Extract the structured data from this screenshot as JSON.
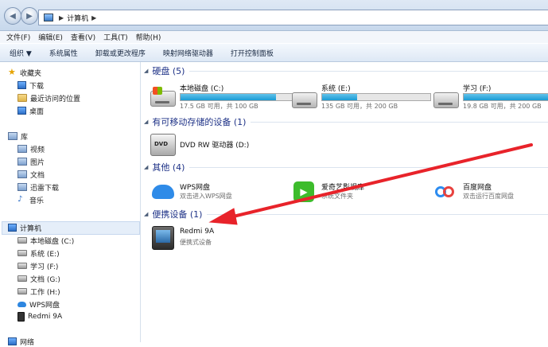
{
  "address": {
    "crumb": "计算机"
  },
  "menu": [
    "文件(F)",
    "编辑(E)",
    "查看(V)",
    "工具(T)",
    "帮助(H)"
  ],
  "toolbar": [
    "组织 ▼",
    "系统属性",
    "卸载或更改程序",
    "映射网络驱动器",
    "打开控制面板"
  ],
  "sidebar": {
    "favorites": {
      "label": "收藏夹",
      "items": [
        "下载",
        "最近访问的位置",
        "桌面"
      ]
    },
    "libraries": {
      "label": "库",
      "items": [
        "视频",
        "图片",
        "文档",
        "迅雷下载",
        "音乐"
      ]
    },
    "computer": {
      "label": "计算机",
      "items": [
        "本地磁盘 (C:)",
        "系统 (E:)",
        "学习 (F:)",
        "文档 (G:)",
        "工作 (H:)",
        "WPS网盘",
        "Redmi 9A"
      ]
    },
    "network": {
      "label": "网络"
    }
  },
  "groups": {
    "hdd": {
      "title": "硬盘 (5)"
    },
    "removable": {
      "title": "有可移动存储的设备 (1)"
    },
    "other": {
      "title": "其他 (4)"
    },
    "portable": {
      "title": "便携设备 (1)"
    }
  },
  "drives": [
    {
      "name": "本地磁盘 (C:)",
      "free": "17.5 GB 可用，共 100 GB",
      "used_fraction": 0.825
    },
    {
      "name": "系统 (E:)",
      "free": "135 GB 可用，共 200 GB",
      "used_fraction": 0.325
    },
    {
      "name": "学习 (F:)",
      "free": "19.8 GB 可用，共 200 GB",
      "used_fraction": 0.9
    }
  ],
  "removable": {
    "name": "DVD RW 驱动器 (D:)",
    "icon_text": "DVD"
  },
  "other": [
    {
      "name": "WPS网盘",
      "sub": "双击进入WPS网盘"
    },
    {
      "name": "爱奇艺影视库",
      "sub": "系统文件夹"
    },
    {
      "name": "百度网盘",
      "sub": "双击运行百度网盘"
    }
  ],
  "portable": {
    "name": "Redmi 9A",
    "sub": "便携式设备"
  },
  "colors": {
    "annotation_arrow": "#e8232a",
    "group_title": "#1e3287",
    "bar_fill": "#1a9bd4"
  }
}
